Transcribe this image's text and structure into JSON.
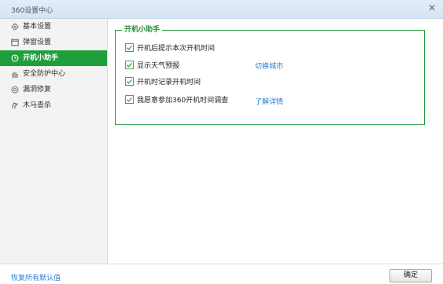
{
  "window": {
    "title": "360设置中心",
    "close_glyph": "✕"
  },
  "sidebar": {
    "items": [
      {
        "label": "基本设置",
        "icon": "gear-icon",
        "active": false
      },
      {
        "label": "弹窗设置",
        "icon": "window-icon",
        "active": false
      },
      {
        "label": "开机小助手",
        "icon": "clock-icon",
        "active": true
      },
      {
        "label": "安全防护中心",
        "icon": "shield-bars-icon",
        "active": false
      },
      {
        "label": "漏洞修复",
        "icon": "patch-icon",
        "active": false
      },
      {
        "label": "木马查杀",
        "icon": "horse-icon",
        "active": false
      }
    ]
  },
  "main": {
    "group_title": "开机小助手",
    "options": [
      {
        "label": "开机后提示本次开机时间",
        "checked": true
      },
      {
        "label": "显示天气预报",
        "checked": true,
        "link": "切换城市"
      },
      {
        "label": "开机时记录开机时间",
        "checked": true
      },
      {
        "label": "我愿意参加360开机时间调查",
        "checked": true,
        "link": "了解详情"
      }
    ]
  },
  "footer": {
    "restore_label": "恢复所有默认值",
    "ok_label": "确定"
  },
  "colors": {
    "accent_green": "#1e9f3b",
    "link_blue": "#2a7fd4"
  }
}
